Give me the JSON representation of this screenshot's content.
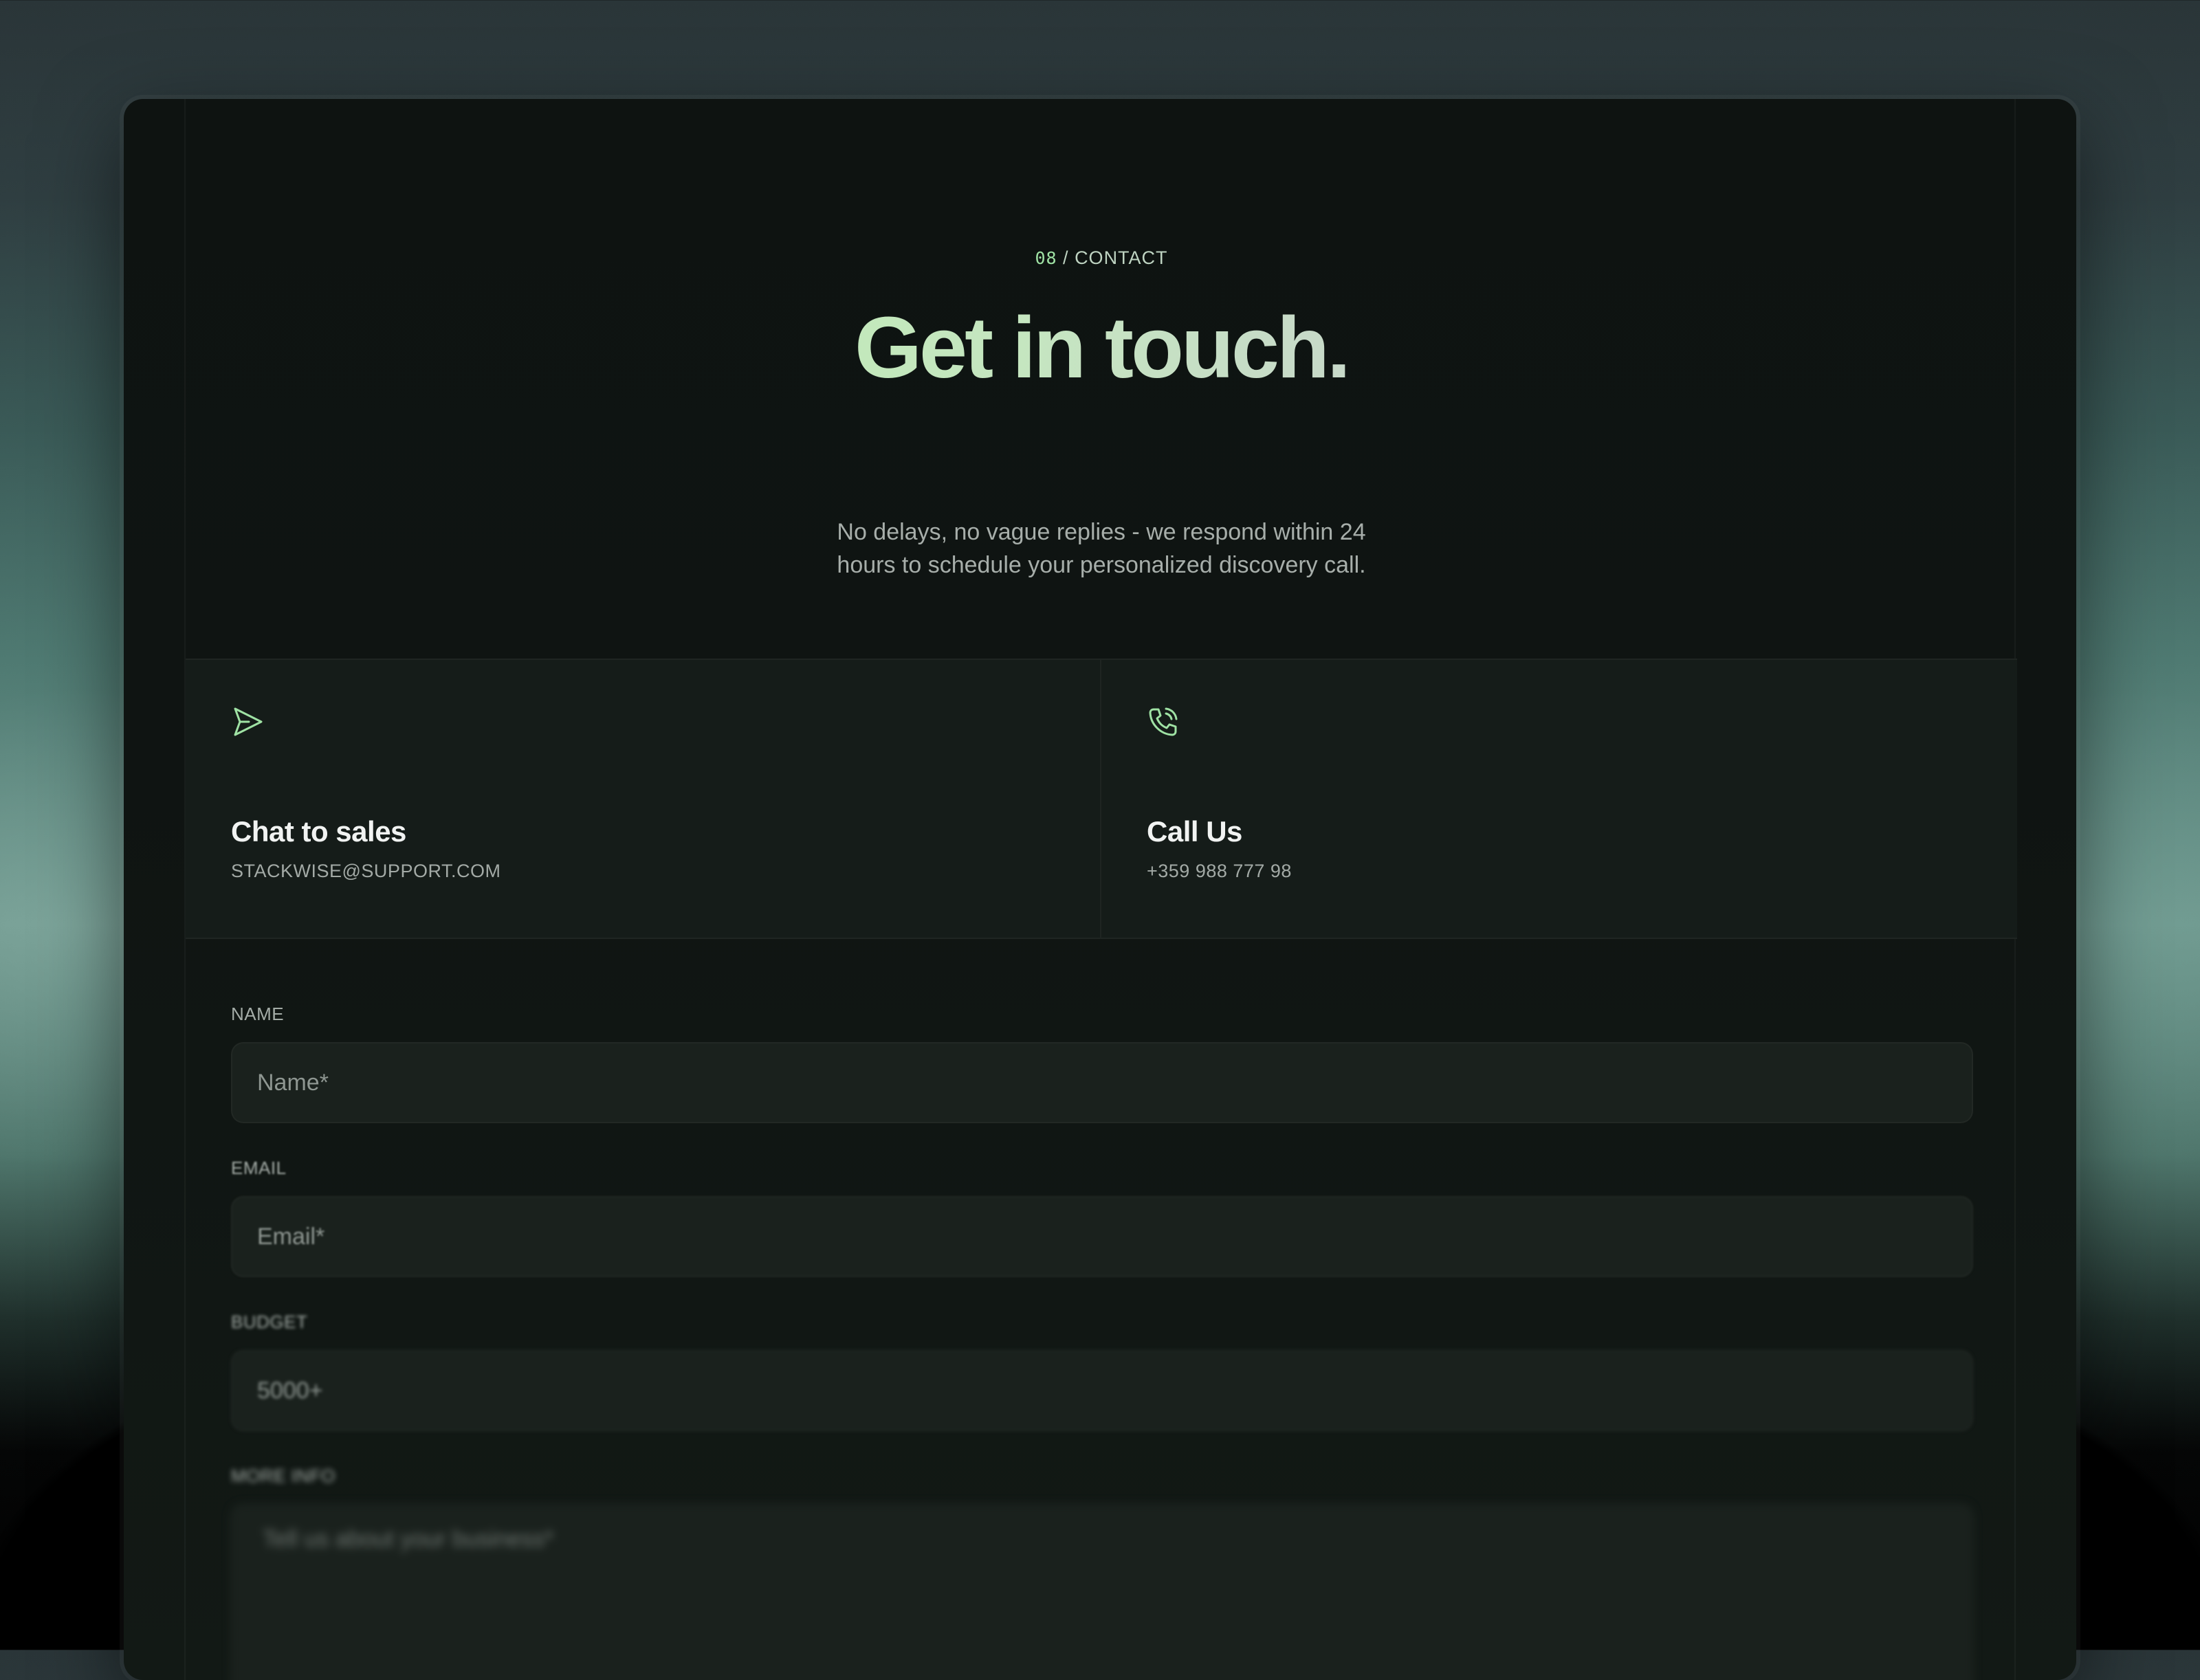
{
  "section": {
    "number": "08",
    "separator": " / ",
    "label": "CONTACT"
  },
  "title": "Get in touch.",
  "subtitle": {
    "line1": "No delays, no vague replies - we respond within 24",
    "line2": "hours to schedule your personalized discovery call."
  },
  "cards": [
    {
      "icon": "send-icon",
      "title": "Chat to sales",
      "detail": "STACKWISE@SUPPORT.COM"
    },
    {
      "icon": "phone-call-icon",
      "title": "Call Us",
      "detail": "+359 988 777 98"
    }
  ],
  "form": {
    "name": {
      "label": "NAME",
      "placeholder": "Name*"
    },
    "email": {
      "label": "EMAIL",
      "placeholder": "Email*"
    },
    "budget": {
      "label": "BUDGET",
      "placeholder": "5000+"
    },
    "more_info": {
      "label": "MORE INFO",
      "placeholder": "Tell us about your business*"
    }
  },
  "colors": {
    "accent": "#9fe2a4",
    "background": "#0f1412",
    "card": "#151c19",
    "input": "#1a211d"
  }
}
